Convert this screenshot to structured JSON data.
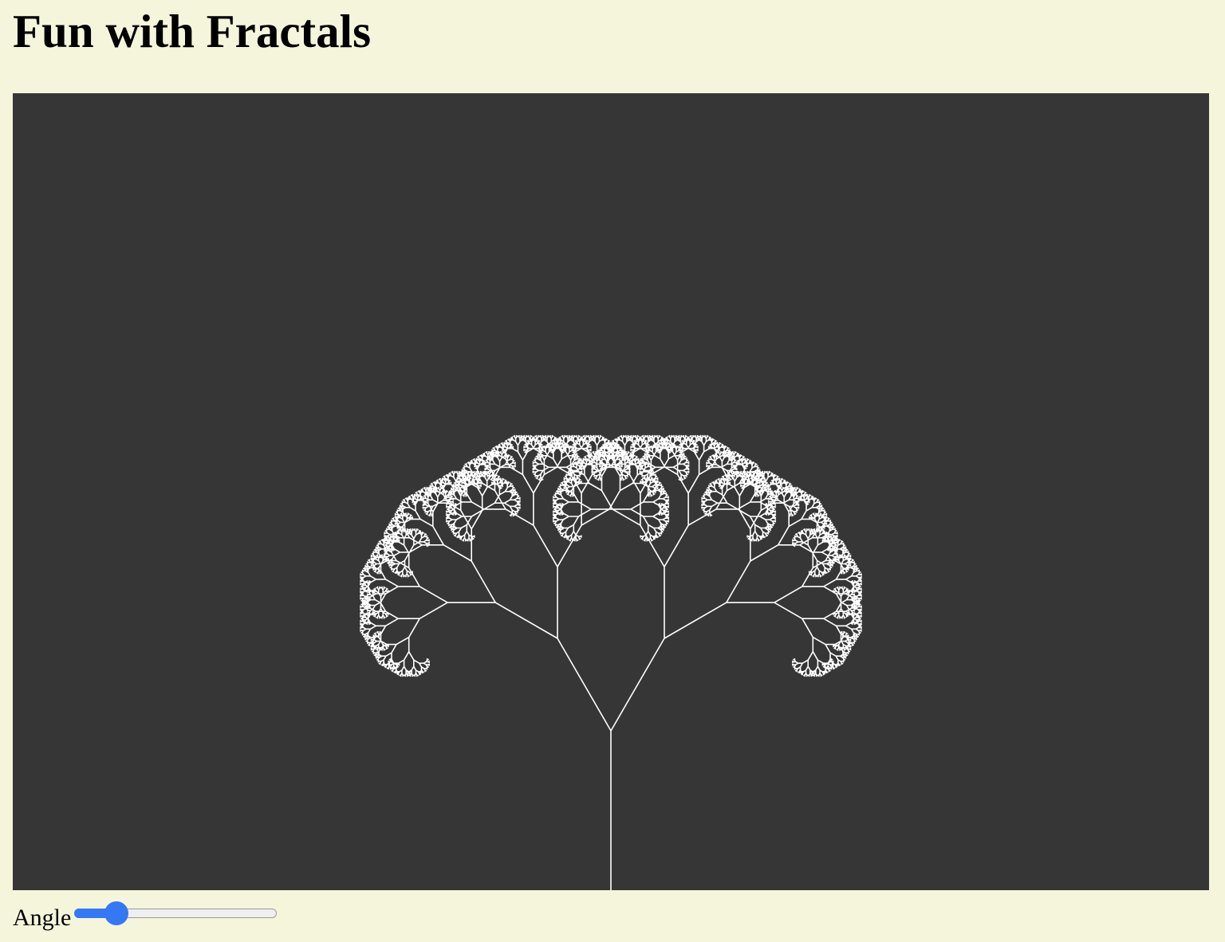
{
  "page": {
    "title": "Fun with Fractals",
    "background": "#f5f5dc"
  },
  "canvas": {
    "background": "#363636",
    "stroke": "#ffffff",
    "tree": {
      "depth": 12,
      "branch_angle_degrees": 30,
      "length_ratio": 0.67
    }
  },
  "controls": {
    "angle_label": "Angle",
    "angle_slider": {
      "value": 30,
      "min": 0,
      "max": 180,
      "accent": "#3478f6"
    }
  }
}
